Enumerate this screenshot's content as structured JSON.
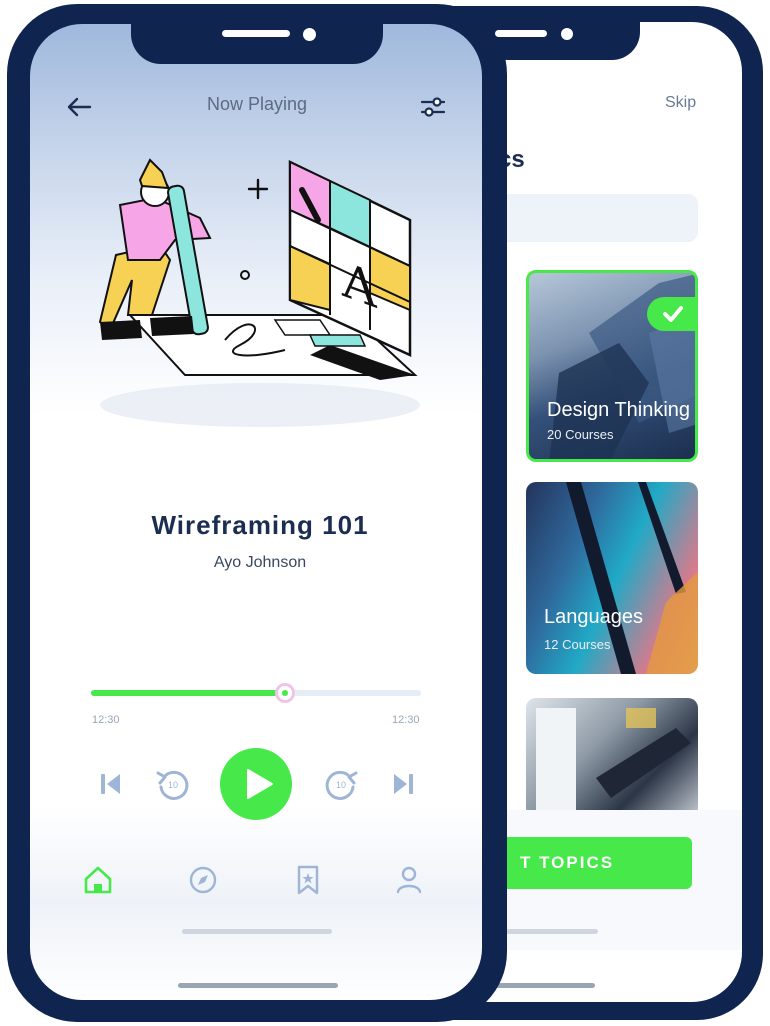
{
  "back_screen": {
    "skip_label": "Skip",
    "heading_partial": "cs",
    "cards": [
      {
        "title": "Design Thinking",
        "subtitle": "20 Courses",
        "selected": true
      },
      {
        "title": "Languages",
        "subtitle": "12 Courses",
        "selected": false
      },
      {
        "title": "",
        "subtitle": "",
        "selected": false
      }
    ],
    "cta_label": "T TOPICS"
  },
  "player": {
    "header_title": "Now Playing",
    "track_title": "Wireframing 101",
    "artist": "Ayo Johnson",
    "progress": 0.58,
    "elapsed": "12:30",
    "duration": "12:30",
    "controls": [
      "skip-previous-icon",
      "rewind-10-icon",
      "play-icon",
      "forward-10-icon",
      "skip-next-icon"
    ],
    "rewind_label": "10",
    "forward_label": "10"
  },
  "tabs": [
    {
      "name": "home",
      "icon": "home-icon",
      "active": true
    },
    {
      "name": "explore",
      "icon": "compass-icon",
      "active": false
    },
    {
      "name": "bookmarks",
      "icon": "bookmark-icon",
      "active": false
    },
    {
      "name": "profile",
      "icon": "user-icon",
      "active": false
    }
  ],
  "colors": {
    "accent": "#47e84a",
    "frame": "#0f2550",
    "text_dark": "#1b2d50",
    "muted": "#5d6b82"
  }
}
